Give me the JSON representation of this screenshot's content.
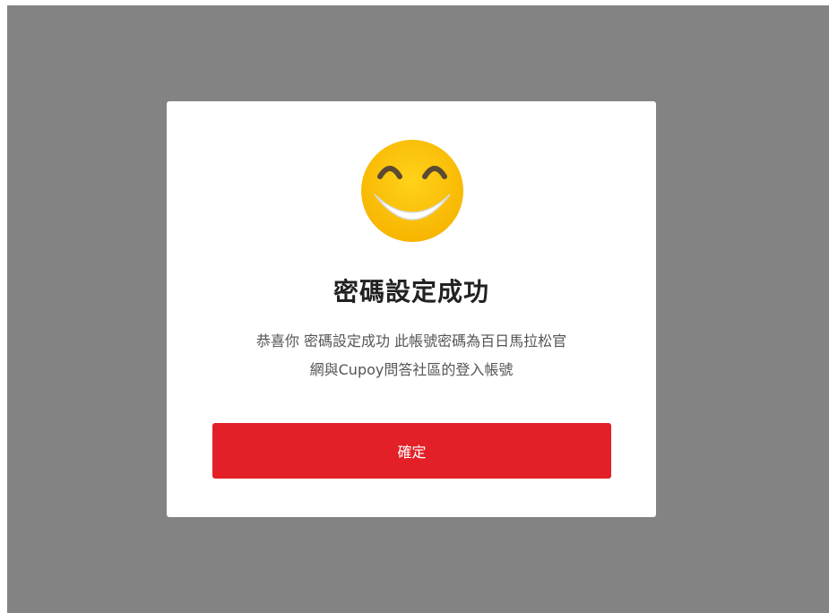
{
  "dialog": {
    "icon": "smiley-face-icon",
    "title": "密碼設定成功",
    "message_line1": "恭喜你 密碼設定成功 此帳號密碼為百日馬拉松官",
    "message_line2": "網與Cupoy問答社區的登入帳號",
    "confirm_label": "確定"
  },
  "colors": {
    "overlay": "#838383",
    "modal_background": "#ffffff",
    "confirm_button": "#e32028",
    "smiley_face": "#fbbf00",
    "smiley_features": "#5a4a32"
  }
}
